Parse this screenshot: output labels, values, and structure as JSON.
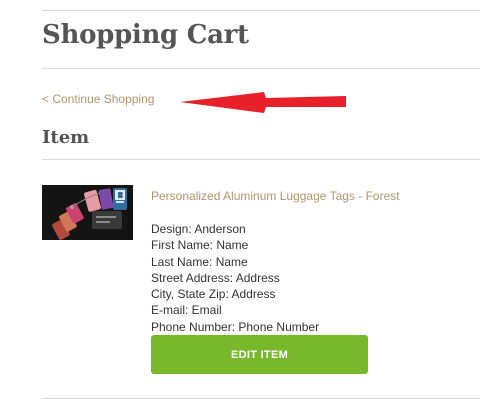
{
  "page": {
    "title": "Shopping Cart",
    "continue_label": "< Continue Shopping",
    "section_heading": "Item"
  },
  "cart_item": {
    "name": "Personalized Aluminum Luggage Tags - Forest",
    "details": [
      "Design: Anderson",
      "First Name: Name",
      "Last Name: Name",
      "Street Address: Address",
      "City, State Zip: Address",
      "E-mail: Email",
      "Phone Number: Phone Number"
    ],
    "edit_label": "EDIT ITEM"
  },
  "colors": {
    "link": "#b0956a",
    "button": "#79b82b",
    "annotation_arrow": "#e8202a"
  },
  "icons": {
    "annotation": "red-arrow-icon",
    "thumbnail": "luggage-tags-photo"
  }
}
